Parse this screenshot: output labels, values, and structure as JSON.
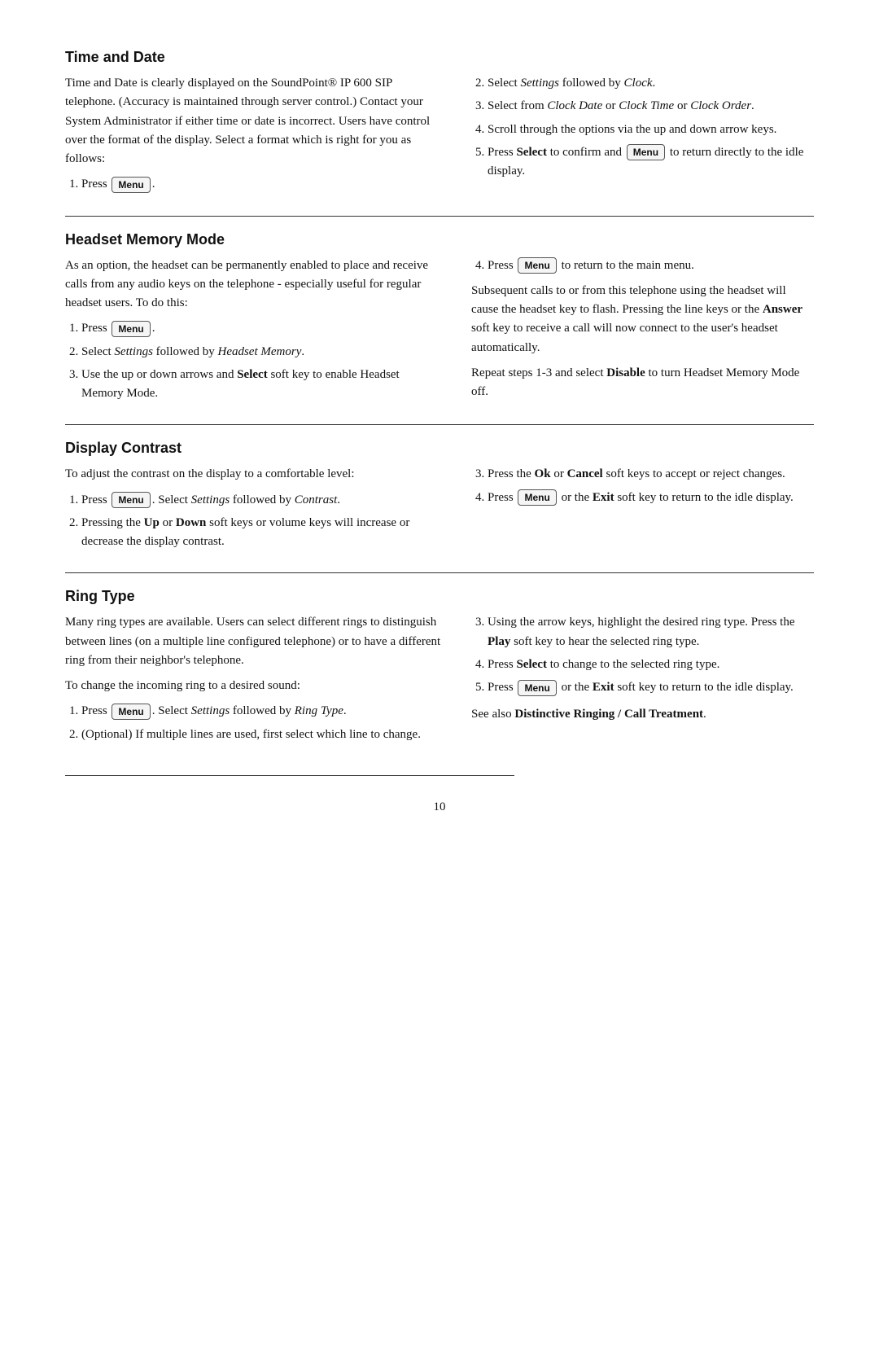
{
  "sections": [
    {
      "id": "time-and-date",
      "title": "Time and Date",
      "left": {
        "intro": "Time and Date is clearly displayed on the SoundPoint® IP 600 SIP telephone.  (Accuracy is maintained through server control.)  Contact your System Administrator if either time or date is incorrect.  Users have control over the format of the display.  Select a format which is right for you as follows:",
        "steps": [
          "Press [Menu]."
        ]
      },
      "right": {
        "steps": [
          "Select Settings followed by Clock.",
          "Select from Clock Date or Clock Time or Clock Order.",
          "Scroll through the options via the up and down arrow keys.",
          "Press Select to confirm and [Menu] to return directly to the idle display."
        ]
      }
    },
    {
      "id": "headset-memory-mode",
      "title": "Headset Memory Mode",
      "left": {
        "intro": "As an option, the headset can be permanently enabled to place and receive calls from any audio keys on the telephone - especially useful for regular headset users.  To do this:",
        "steps": [
          "Press [Menu].",
          "Select Settings followed by Headset Memory.",
          "Use the up or down arrows and Select soft key to enable Headset Memory Mode."
        ]
      },
      "right": {
        "step4": "Press [Menu] to return to the main menu.",
        "para1": "Subsequent calls to or from this telephone using the headset will cause the headset key to flash.  Pressing the line keys or the Answer soft key to receive a call will now connect to the user's headset automatically.",
        "para2": "Repeat steps 1-3 and select Disable to turn Headset Memory Mode off."
      }
    },
    {
      "id": "display-contrast",
      "title": "Display Contrast",
      "left": {
        "intro": "To adjust the contrast on the display to a comfortable level:",
        "steps": [
          "Press [Menu].  Select Settings followed by Contrast.",
          "Pressing the Up or Down soft keys or volume keys will increase or decrease the display contrast."
        ]
      },
      "right": {
        "steps": [
          "Press the Ok or Cancel soft keys to accept or reject changes.",
          "Press [Menu] or the Exit soft key to return to the idle display."
        ]
      }
    },
    {
      "id": "ring-type",
      "title": "Ring Type",
      "left": {
        "intro1": "Many ring types are available.  Users can select different rings to distinguish between lines (on a multiple line configured telephone) or to have a different ring from their neighbor's telephone.",
        "intro2": "To change the incoming ring to a desired sound:",
        "steps": [
          "Press [Menu].  Select Settings followed by Ring Type.",
          "(Optional)  If multiple lines are used, first select which line to change."
        ]
      },
      "right": {
        "steps": [
          "Using the arrow keys, highlight the desired ring type.  Press the Play soft key to hear the selected ring type.",
          "Press Select to change to the selected ring type.",
          "Press [Menu] or the Exit soft key to return to the idle display."
        ],
        "see_also": "See also Distinctive Ringing / Call Treatment."
      }
    }
  ],
  "page_number": "10",
  "menu_label": "Menu"
}
